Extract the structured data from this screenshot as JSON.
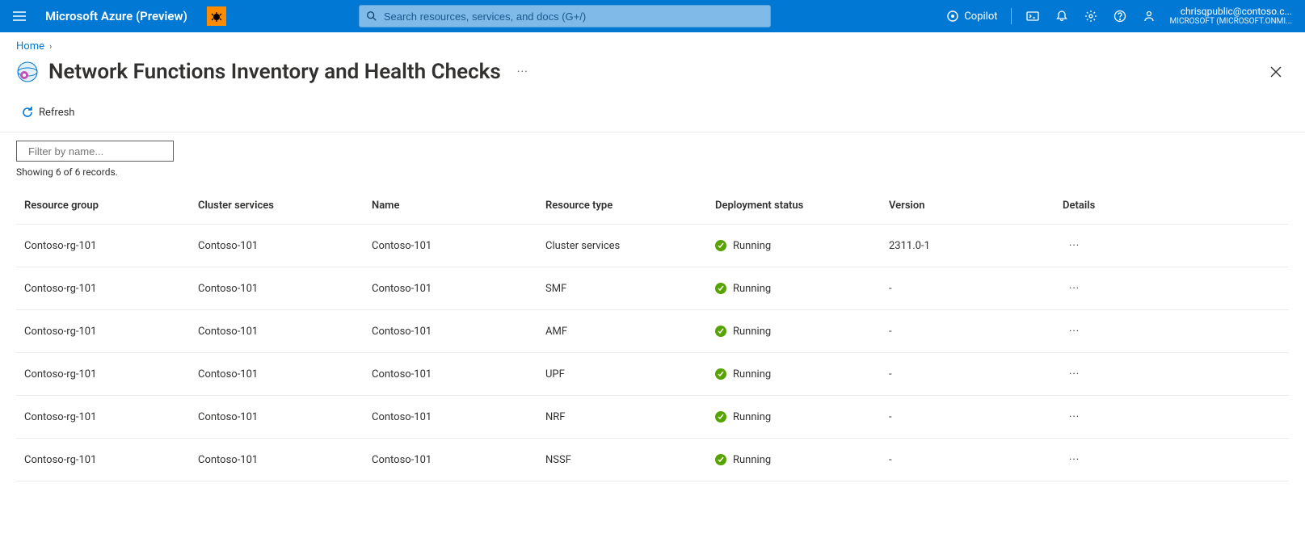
{
  "topbar": {
    "brand": "Microsoft Azure (Preview)",
    "search_placeholder": "Search resources, services, and docs (G+/)",
    "copilot_label": "Copilot",
    "account_email": "chrisqpublic@contoso.c...",
    "account_tenant": "MICROSOFT (MICROSOFT.ONMI..."
  },
  "breadcrumb": {
    "home": "Home"
  },
  "page": {
    "title": "Network Functions Inventory and Health Checks",
    "more": "···"
  },
  "toolbar": {
    "refresh_label": "Refresh"
  },
  "filter": {
    "placeholder": "Filter by name...",
    "records_text": "Showing 6 of 6 records."
  },
  "table": {
    "columns": {
      "resource_group": "Resource group",
      "cluster_services": "Cluster services",
      "name": "Name",
      "resource_type": "Resource type",
      "deployment_status": "Deployment status",
      "version": "Version",
      "details": "Details"
    },
    "rows": [
      {
        "resource_group": "Contoso-rg-101",
        "cluster_services": "Contoso-101",
        "name": "Contoso-101",
        "resource_type": "Cluster services",
        "deployment_status": "Running",
        "version": "2311.0-1"
      },
      {
        "resource_group": "Contoso-rg-101",
        "cluster_services": "Contoso-101",
        "name": "Contoso-101",
        "resource_type": "SMF",
        "deployment_status": "Running",
        "version": "-"
      },
      {
        "resource_group": "Contoso-rg-101",
        "cluster_services": "Contoso-101",
        "name": "Contoso-101",
        "resource_type": "AMF",
        "deployment_status": "Running",
        "version": "-"
      },
      {
        "resource_group": "Contoso-rg-101",
        "cluster_services": "Contoso-101",
        "name": "Contoso-101",
        "resource_type": "UPF",
        "deployment_status": "Running",
        "version": "-"
      },
      {
        "resource_group": "Contoso-rg-101",
        "cluster_services": "Contoso-101",
        "name": "Contoso-101",
        "resource_type": "NRF",
        "deployment_status": "Running",
        "version": "-"
      },
      {
        "resource_group": "Contoso-rg-101",
        "cluster_services": "Contoso-101",
        "name": "Contoso-101",
        "resource_type": "NSSF",
        "deployment_status": "Running",
        "version": "-"
      }
    ],
    "row_more": "···"
  }
}
